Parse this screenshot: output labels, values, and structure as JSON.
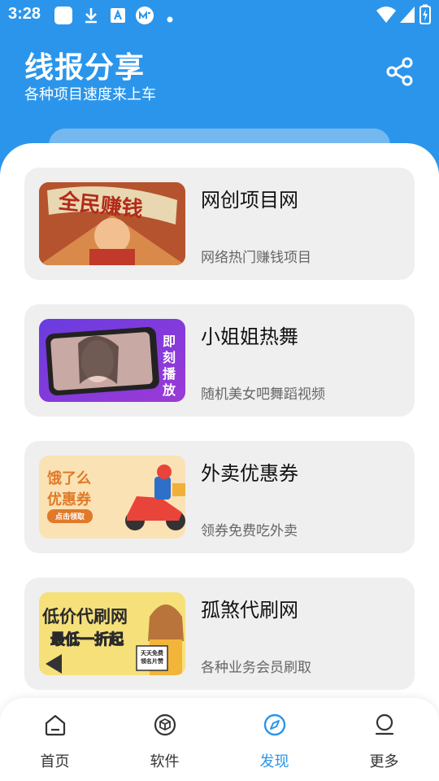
{
  "status_bar": {
    "time": "3:28"
  },
  "header": {
    "title": "线报分享",
    "subtitle": "各种项目速度来上车",
    "share_icon": "share-icon"
  },
  "cards": [
    {
      "title": "网创项目网",
      "desc": "网络热门赚钱项目",
      "thumb_text": "全民赚钱"
    },
    {
      "title": "小姐姐热舞",
      "desc": "随机美女吧舞蹈视频",
      "thumb_text": "即刻播放"
    },
    {
      "title": "外卖优惠券",
      "desc": "领券免费吃外卖",
      "thumb_text_1": "饿了么",
      "thumb_text_2": "优惠券",
      "thumb_btn": "点击领取"
    },
    {
      "title": "孤煞代刷网",
      "desc": "各种业务会员刷取",
      "thumb_text_1": "低价代刷网",
      "thumb_text_2": "最低一折起",
      "thumb_sign": "天天免费领名片赞"
    }
  ],
  "tabs": [
    {
      "label": "首页",
      "icon": "home-icon",
      "active": false
    },
    {
      "label": "软件",
      "icon": "cube-icon",
      "active": false
    },
    {
      "label": "发现",
      "icon": "compass-icon",
      "active": true
    },
    {
      "label": "更多",
      "icon": "user-icon",
      "active": false
    }
  ],
  "colors": {
    "accent": "#2b95eb",
    "card_bg": "#efefef",
    "text_primary": "#111111",
    "text_secondary": "#666666"
  }
}
